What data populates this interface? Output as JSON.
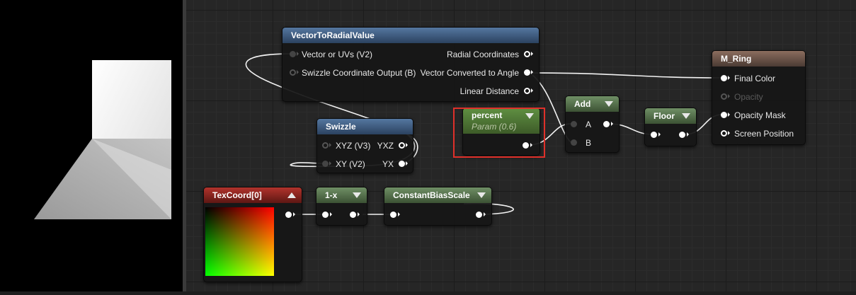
{
  "nodes": {
    "vector_radial": {
      "title": "VectorToRadialValue",
      "inputs": [
        "Vector or UVs (V2)",
        "Swizzle Coordinate Output (B)"
      ],
      "outputs": [
        "Radial Coordinates",
        "Vector Converted to Angle",
        "Linear Distance"
      ]
    },
    "m_ring": {
      "title": "M_Ring",
      "inputs": [
        "Final Color",
        "Opacity",
        "Opacity Mask",
        "Screen Position"
      ]
    },
    "add": {
      "title": "Add",
      "inputs": [
        "A",
        "B"
      ]
    },
    "floor": {
      "title": "Floor"
    },
    "percent": {
      "title": "percent",
      "subtitle": "Param (0.6)"
    },
    "swizzle": {
      "title": "Swizzle",
      "inputs": [
        "XYZ (V3)",
        "XY (V2)"
      ],
      "outputs": [
        "YXZ",
        "YX"
      ]
    },
    "texcoord": {
      "title": "TexCoord[0]"
    },
    "one_minus_x": {
      "title": "1-x"
    },
    "constant_bias_scale": {
      "title": "ConstantBiasScale"
    }
  },
  "colors": {
    "graph_bg": "#262626",
    "highlight": "#e0302a",
    "header_blue": "#3f5b80",
    "header_green": "#55704b",
    "header_red": "#8f2a24",
    "param_green": "#4f7635"
  }
}
